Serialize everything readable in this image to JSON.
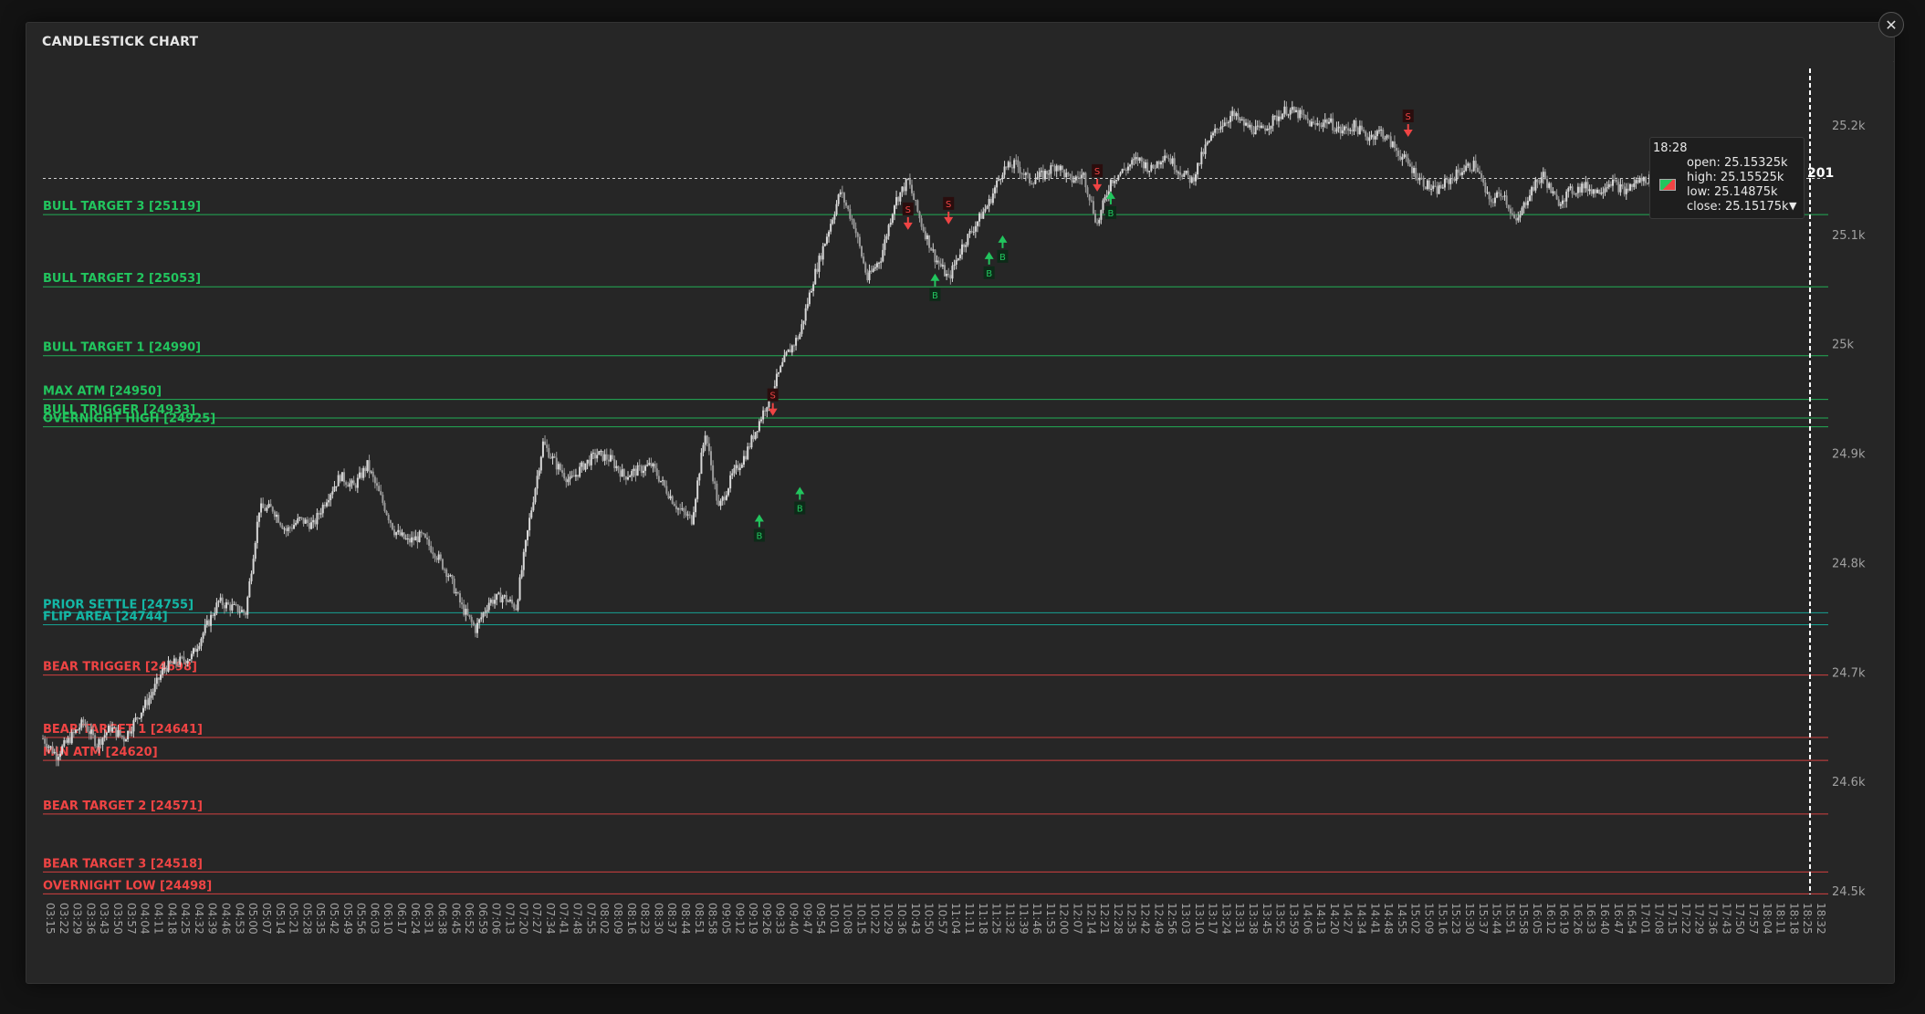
{
  "modal": {
    "title": "CANDLESTICK CHART",
    "close_icon": "close-icon",
    "close_label": "✕"
  },
  "tooltip": {
    "time": "18:28",
    "open": "open: 25.15325k",
    "high": "high: 25.15525k",
    "low": "low: 25.14875k",
    "close": "close: 25.15175k",
    "arrow": "▼",
    "swatch_icon": "candle-swatch-icon"
  },
  "price_chip": "201",
  "chart_data": {
    "type": "candlestick",
    "title": "CANDLESTICK CHART",
    "y_ticks": [
      {
        "value": 24500,
        "label": "24.5k"
      },
      {
        "value": 24600,
        "label": "24.6k"
      },
      {
        "value": 24700,
        "label": "24.7k"
      },
      {
        "value": 24800,
        "label": "24.8k"
      },
      {
        "value": 24900,
        "label": "24.9k"
      },
      {
        "value": 25000,
        "label": "25k"
      },
      {
        "value": 25100,
        "label": "25.1k"
      },
      {
        "value": 25200,
        "label": "25.2k"
      }
    ],
    "ylim": [
      24490,
      25230
    ],
    "x_ticks": [
      "03:15",
      "03:22",
      "03:29",
      "03:36",
      "03:43",
      "03:50",
      "03:57",
      "04:04",
      "04:11",
      "04:18",
      "04:25",
      "04:32",
      "04:39",
      "04:46",
      "04:53",
      "05:00",
      "05:07",
      "05:14",
      "05:21",
      "05:28",
      "05:35",
      "05:42",
      "05:49",
      "05:56",
      "06:03",
      "06:10",
      "06:17",
      "06:24",
      "06:31",
      "06:38",
      "06:45",
      "06:52",
      "06:59",
      "07:06",
      "07:13",
      "07:20",
      "07:27",
      "07:34",
      "07:41",
      "07:48",
      "07:55",
      "08:02",
      "08:09",
      "08:16",
      "08:23",
      "08:30",
      "08:37",
      "08:44",
      "08:51",
      "08:58",
      "09:05",
      "09:12",
      "09:19",
      "09:26",
      "09:33",
      "09:40",
      "09:47",
      "09:54",
      "10:01",
      "10:08",
      "10:15",
      "10:22",
      "10:29",
      "10:36",
      "10:43",
      "10:50",
      "10:57",
      "11:04",
      "11:11",
      "11:18",
      "11:25",
      "11:32",
      "11:39",
      "11:46",
      "11:53",
      "12:00",
      "12:07",
      "12:14",
      "12:21",
      "12:28",
      "12:35",
      "12:42",
      "12:49",
      "12:56",
      "13:03",
      "13:10",
      "13:17",
      "13:24",
      "13:31",
      "13:38",
      "13:45",
      "13:52",
      "13:59",
      "14:06",
      "14:13",
      "14:20",
      "14:27",
      "14:34",
      "14:41",
      "14:48",
      "14:55",
      "15:02",
      "15:09",
      "15:16",
      "15:23",
      "15:30",
      "15:37",
      "15:44",
      "15:51",
      "15:58",
      "16:05",
      "16:12",
      "16:19",
      "16:26",
      "16:33",
      "16:40",
      "16:47",
      "16:54",
      "17:01",
      "17:08",
      "17:15",
      "17:22",
      "17:29",
      "17:36",
      "17:43",
      "17:50",
      "17:57",
      "18:04",
      "18:11",
      "18:18",
      "18:25",
      "18:32"
    ],
    "price_path": [
      [
        "03:15",
        24640
      ],
      [
        "03:22",
        24625
      ],
      [
        "03:29",
        24640
      ],
      [
        "03:36",
        24655
      ],
      [
        "03:43",
        24635
      ],
      [
        "03:50",
        24650
      ],
      [
        "03:57",
        24640
      ],
      [
        "04:04",
        24660
      ],
      [
        "04:11",
        24680
      ],
      [
        "04:18",
        24705
      ],
      [
        "04:25",
        24710
      ],
      [
        "04:32",
        24715
      ],
      [
        "04:39",
        24740
      ],
      [
        "04:46",
        24765
      ],
      [
        "04:53",
        24760
      ],
      [
        "05:00",
        24755
      ],
      [
        "05:07",
        24850
      ],
      [
        "05:14",
        24850
      ],
      [
        "05:21",
        24830
      ],
      [
        "05:28",
        24840
      ],
      [
        "05:35",
        24835
      ],
      [
        "05:42",
        24860
      ],
      [
        "05:49",
        24880
      ],
      [
        "05:56",
        24870
      ],
      [
        "06:03",
        24890
      ],
      [
        "06:10",
        24860
      ],
      [
        "06:17",
        24830
      ],
      [
        "06:24",
        24820
      ],
      [
        "06:31",
        24825
      ],
      [
        "06:38",
        24810
      ],
      [
        "06:45",
        24790
      ],
      [
        "06:52",
        24760
      ],
      [
        "06:59",
        24740
      ],
      [
        "07:06",
        24765
      ],
      [
        "07:13",
        24770
      ],
      [
        "07:20",
        24760
      ],
      [
        "07:27",
        24840
      ],
      [
        "07:34",
        24910
      ],
      [
        "07:41",
        24890
      ],
      [
        "07:48",
        24875
      ],
      [
        "07:55",
        24890
      ],
      [
        "08:02",
        24900
      ],
      [
        "08:09",
        24895
      ],
      [
        "08:16",
        24880
      ],
      [
        "08:23",
        24885
      ],
      [
        "08:30",
        24890
      ],
      [
        "08:37",
        24870
      ],
      [
        "08:44",
        24850
      ],
      [
        "08:51",
        24840
      ],
      [
        "08:58",
        24920
      ],
      [
        "09:05",
        24850
      ],
      [
        "09:12",
        24880
      ],
      [
        "09:19",
        24900
      ],
      [
        "09:26",
        24930
      ],
      [
        "09:33",
        24960
      ],
      [
        "09:40",
        24990
      ],
      [
        "09:47",
        25010
      ],
      [
        "09:54",
        25060
      ],
      [
        "10:01",
        25100
      ],
      [
        "10:08",
        25140
      ],
      [
        "10:15",
        25110
      ],
      [
        "10:22",
        25060
      ],
      [
        "10:29",
        25080
      ],
      [
        "10:36",
        25130
      ],
      [
        "10:43",
        25150
      ],
      [
        "10:50",
        25110
      ],
      [
        "10:57",
        25080
      ],
      [
        "11:04",
        25060
      ],
      [
        "11:11",
        25090
      ],
      [
        "11:18",
        25110
      ],
      [
        "11:25",
        25130
      ],
      [
        "11:32",
        25160
      ],
      [
        "11:39",
        25165
      ],
      [
        "11:46",
        25150
      ],
      [
        "11:53",
        25155
      ],
      [
        "12:00",
        25165
      ],
      [
        "12:07",
        25150
      ],
      [
        "12:14",
        25155
      ],
      [
        "12:21",
        25110
      ],
      [
        "12:28",
        25150
      ],
      [
        "12:35",
        25160
      ],
      [
        "12:42",
        25170
      ],
      [
        "12:49",
        25160
      ],
      [
        "12:56",
        25175
      ],
      [
        "13:03",
        25160
      ],
      [
        "13:10",
        25150
      ],
      [
        "13:17",
        25180
      ],
      [
        "13:24",
        25200
      ],
      [
        "13:31",
        25210
      ],
      [
        "13:38",
        25200
      ],
      [
        "13:45",
        25195
      ],
      [
        "13:52",
        25205
      ],
      [
        "13:59",
        25215
      ],
      [
        "14:06",
        25210
      ],
      [
        "14:13",
        25200
      ],
      [
        "14:20",
        25205
      ],
      [
        "14:27",
        25195
      ],
      [
        "14:34",
        25200
      ],
      [
        "14:41",
        25190
      ],
      [
        "14:48",
        25195
      ],
      [
        "14:55",
        25180
      ],
      [
        "15:02",
        25165
      ],
      [
        "15:09",
        25150
      ],
      [
        "15:16",
        25140
      ],
      [
        "15:23",
        25150
      ],
      [
        "15:30",
        25160
      ],
      [
        "15:37",
        25165
      ],
      [
        "15:44",
        25130
      ],
      [
        "15:51",
        25140
      ],
      [
        "15:58",
        25110
      ],
      [
        "16:05",
        25140
      ],
      [
        "16:12",
        25155
      ],
      [
        "16:19",
        25130
      ],
      [
        "16:26",
        25140
      ],
      [
        "16:33",
        25145
      ],
      [
        "16:40",
        25140
      ],
      [
        "16:47",
        25150
      ],
      [
        "16:54",
        25140
      ],
      [
        "17:01",
        25150
      ],
      [
        "17:08",
        25152
      ],
      [
        "17:15",
        25150
      ],
      [
        "17:22",
        25148
      ],
      [
        "17:29",
        25152
      ],
      [
        "17:36",
        25150
      ],
      [
        "17:43",
        25152
      ],
      [
        "17:50",
        25151
      ],
      [
        "17:57",
        25152
      ],
      [
        "18:04",
        25152
      ],
      [
        "18:11",
        25151
      ],
      [
        "18:18",
        25153
      ],
      [
        "18:25",
        25152
      ]
    ],
    "levels": [
      {
        "label": "BULL TARGET 3 [25119]",
        "value": 25119,
        "color": "#22c55e"
      },
      {
        "label": "BULL TARGET 2 [25053]",
        "value": 25053,
        "color": "#22c55e"
      },
      {
        "label": "BULL TARGET 1 [24990]",
        "value": 24990,
        "color": "#22c55e"
      },
      {
        "label": "MAX ATM [24950]",
        "value": 24950,
        "color": "#22c55e"
      },
      {
        "label": "BULL TRIGGER [24933]",
        "value": 24933,
        "color": "#22c55e"
      },
      {
        "label": "OVERNIGHT HIGH [24925]",
        "value": 24925,
        "color": "#22c55e"
      },
      {
        "label": "PRIOR SETTLE [24755]",
        "value": 24755,
        "color": "#14b8a6"
      },
      {
        "label": "FLIP AREA [24744]",
        "value": 24744,
        "color": "#14b8a6"
      },
      {
        "label": "BEAR TRIGGER [24698]",
        "value": 24698,
        "color": "#ef4444"
      },
      {
        "label": "BEAR TARGET 1 [24641]",
        "value": 24641,
        "color": "#ef4444"
      },
      {
        "label": "MIN ATM [24620]",
        "value": 24620,
        "color": "#ef4444"
      },
      {
        "label": "BEAR TARGET 2 [24571]",
        "value": 24571,
        "color": "#ef4444"
      },
      {
        "label": "BEAR TARGET 3 [24518]",
        "value": 24518,
        "color": "#ef4444"
      },
      {
        "label": "OVERNIGHT LOW [24498]",
        "value": 24498,
        "color": "#ef4444"
      }
    ],
    "current_price": 25152,
    "signals": [
      {
        "type": "B",
        "time": "09:26",
        "price": 24845
      },
      {
        "type": "S",
        "time": "09:33",
        "price": 24935
      },
      {
        "type": "B",
        "time": "09:47",
        "price": 24870
      },
      {
        "type": "S",
        "time": "10:43",
        "price": 25105
      },
      {
        "type": "B",
        "time": "10:57",
        "price": 25065
      },
      {
        "type": "S",
        "time": "11:04",
        "price": 25110
      },
      {
        "type": "B",
        "time": "11:25",
        "price": 25085
      },
      {
        "type": "B",
        "time": "11:32",
        "price": 25100
      },
      {
        "type": "S",
        "time": "12:21",
        "price": 25140
      },
      {
        "type": "B",
        "time": "12:28",
        "price": 25140
      },
      {
        "type": "S",
        "time": "15:02",
        "price": 25190
      }
    ],
    "colors": {
      "up": "#d8d8d8",
      "down": "#9a9a9a",
      "buy": "#22c55e",
      "sell": "#ef4444",
      "grid": "#2f2f2f",
      "axis_text": "#a0a0a0"
    }
  }
}
